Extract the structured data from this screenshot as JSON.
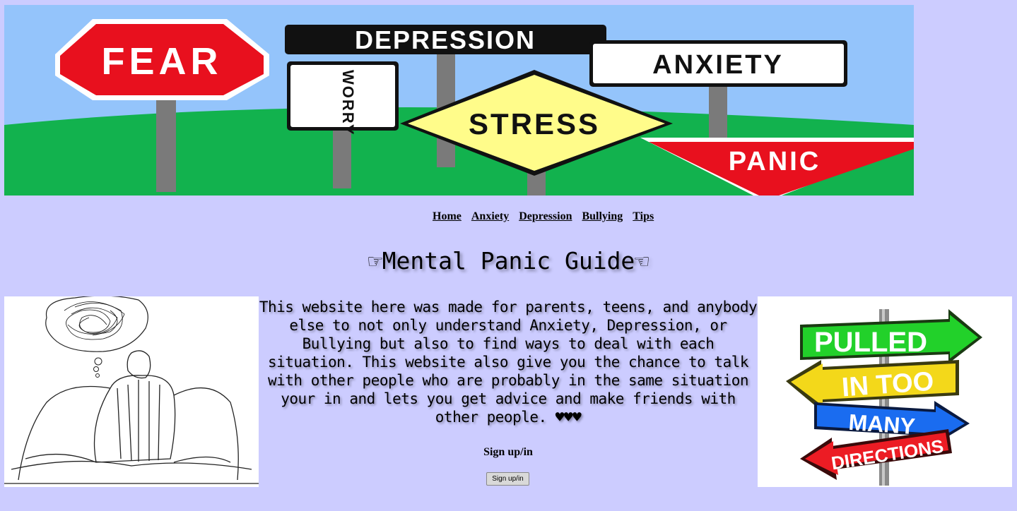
{
  "banner": {
    "signs": [
      "FEAR",
      "DEPRESSION",
      "ANXIETY",
      "WORRY",
      "STRESS",
      "PANIC"
    ]
  },
  "nav": {
    "links": [
      "Home",
      "Anxiety",
      "Depression",
      "Bullying",
      "Tips"
    ]
  },
  "page_title": "☞Mental Panic Guide☜",
  "intro_text": "This website here was made for parents, teens, and anybody else to not only understand Anxiety, Depression, or Bullying but also to find ways to deal with each situation. This website also give you the chance to talk with other people who are probably in the same situation your in and lets you get advice and make friends with other people. ♥♥♥",
  "signup": {
    "heading": "Sign up/in",
    "button_label": "Sign up/in"
  },
  "right_image": {
    "arrows": [
      "PULLED",
      "IN TOO",
      "MANY",
      "DIRECTIONS"
    ]
  },
  "colors": {
    "background": "#ccccff",
    "sky": "#94c4fb",
    "grass": "#12b24e",
    "stop_red": "#e8101e",
    "yield_yellow": "#fffc8a"
  }
}
